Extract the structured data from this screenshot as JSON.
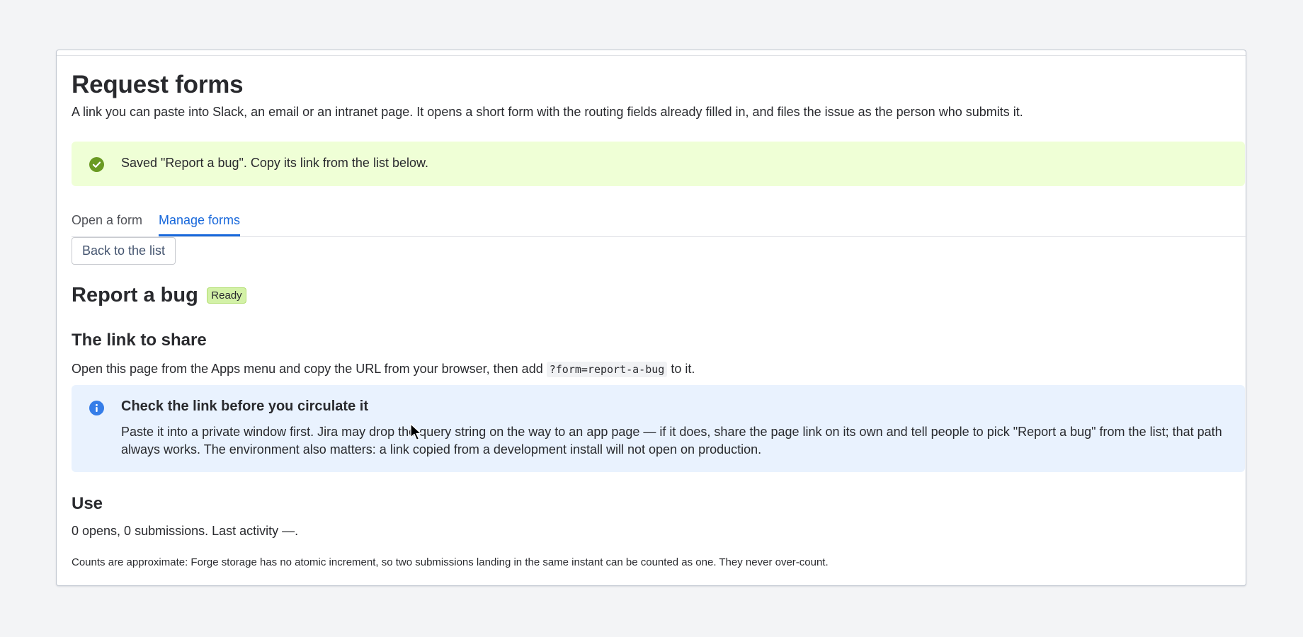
{
  "page": {
    "title": "Request forms",
    "intro": "A link you can paste into Slack, an email or an intranet page. It opens a short form with the routing fields already filled in, and files the issue as the person who submits it."
  },
  "success_banner": {
    "icon": "check-circle-icon",
    "message": "Saved \"Report a bug\". Copy its link from the list below.",
    "color": "#6a9a23",
    "background": "#efffd6"
  },
  "tabs": {
    "open_form": "Open a form",
    "manage_forms": "Manage forms",
    "active": "manage_forms",
    "accent": "#1868db"
  },
  "back_button": {
    "label": "Back to the list"
  },
  "form": {
    "title": "Report a bug",
    "status": "Ready"
  },
  "link_section": {
    "heading": "The link to share",
    "instruction_before": "Open this page from the Apps menu and copy the URL from your browser, then add",
    "query_code": "?form=report-a-bug",
    "instruction_after": "to it."
  },
  "info_banner": {
    "icon": "info-icon",
    "title": "Check the link before you circulate it",
    "body": "Paste it into a private window first. Jira may drop the query string on the way to an app page — if it does, share the page link on its own and tell people to pick \"Report a bug\" from the list; that path always works. The environment also matters: a link copied from a development install will not open on production.",
    "background": "#e9f2fe"
  },
  "use_section": {
    "heading": "Use",
    "stats": "0 opens, 0 submissions. Last activity —.",
    "note": "Counts are approximate: Forge storage has no atomic increment, so two submissions landing in the same instant can be counted as one. They never over-count."
  }
}
